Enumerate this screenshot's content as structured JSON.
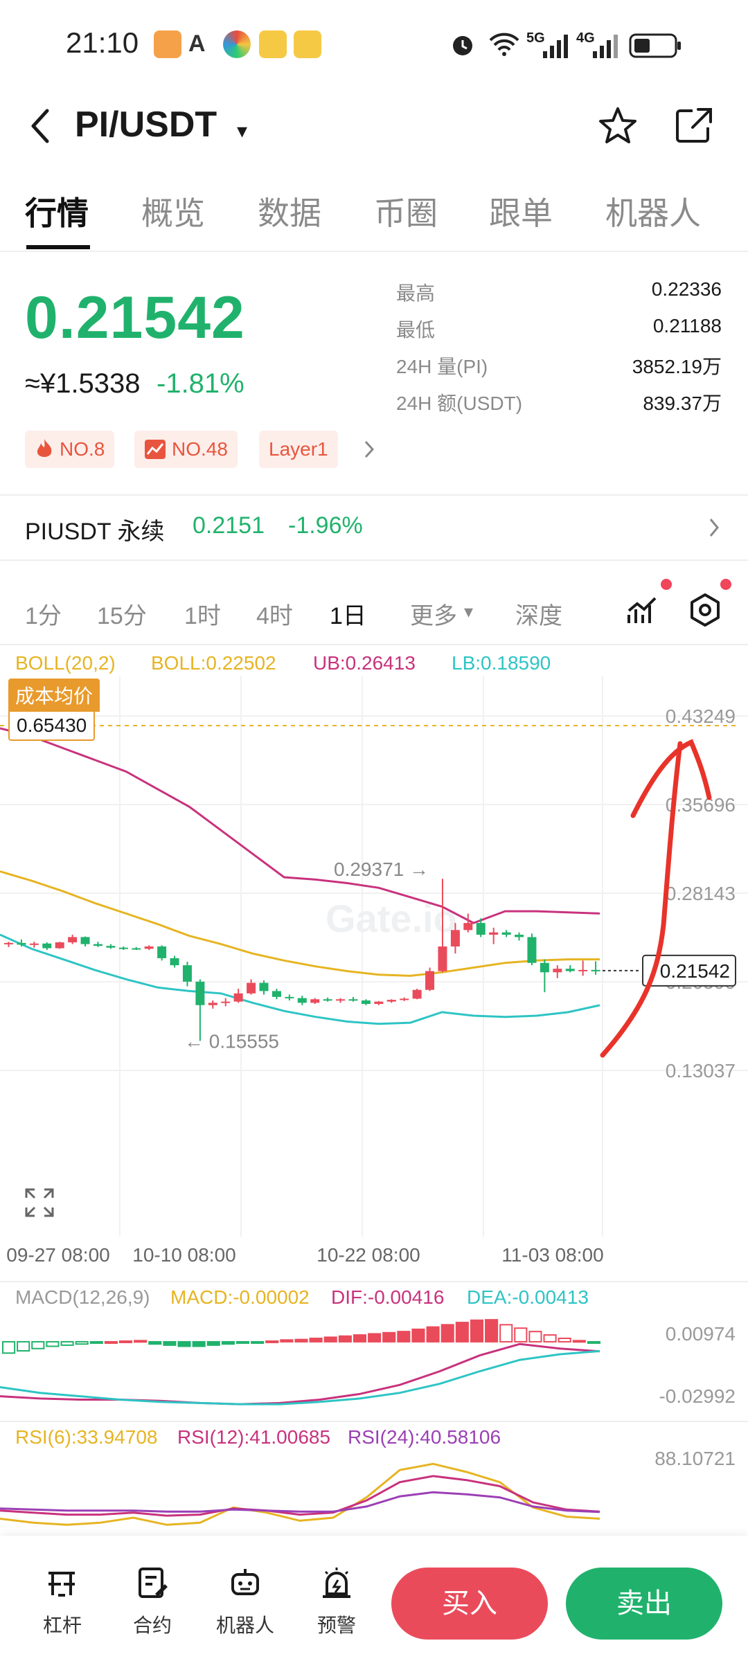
{
  "status_bar": {
    "time": "21:10",
    "network_5g": "5G",
    "network_4g": "4G"
  },
  "header": {
    "pair": "PI/USDT",
    "caret": "▾"
  },
  "tabs": [
    {
      "label": "行情"
    },
    {
      "label": "概览"
    },
    {
      "label": "数据"
    },
    {
      "label": "币圈"
    },
    {
      "label": "跟单"
    },
    {
      "label": "机器人"
    }
  ],
  "price": {
    "last": "0.21542",
    "cny": "≈¥1.5338",
    "change": "-1.81%"
  },
  "stats": [
    {
      "label": "最高",
      "value": "0.22336"
    },
    {
      "label": "最低",
      "value": "0.21188"
    },
    {
      "label": "24H 量(PI)",
      "value": "3852.19万"
    },
    {
      "label": "24H 额(USDT)",
      "value": "839.37万"
    }
  ],
  "tags": [
    "NO.8",
    "NO.48",
    "Layer1"
  ],
  "perpetual": {
    "name": "PIUSDT 永续",
    "price": "0.2151",
    "change": "-1.96%"
  },
  "intervals": [
    {
      "label": "1分"
    },
    {
      "label": "15分"
    },
    {
      "label": "1时"
    },
    {
      "label": "4时"
    },
    {
      "label": "1日"
    },
    {
      "label": "更多"
    },
    {
      "label": "深度"
    }
  ],
  "more_caret": "▾",
  "boll": {
    "name": "BOLL(20,2)",
    "boll": "BOLL:0.22502",
    "ub": "UB:0.26413",
    "lb": "LB:0.18590"
  },
  "cost_avg": {
    "label": "成本均价",
    "value": "0.65430"
  },
  "watermark": "Gate.io",
  "chart_data": [
    {
      "type": "candlestick",
      "title": "",
      "y_ticks": [
        "0.43249",
        "0.35696",
        "0.28143",
        "0.20590",
        "0.13037"
      ],
      "x_ticks": [
        "09-27 08:00",
        "10-10 08:00",
        "10-22 08:00",
        "11-03 08:00"
      ],
      "current_price_label": "0.21542",
      "high_annotation": "0.29371 →",
      "low_annotation": "← 0.15555",
      "ylim": [
        0.13037,
        0.43249
      ],
      "candles": [
        [
          0.238,
          0.24,
          0.2355,
          0.239
        ],
        [
          0.239,
          0.242,
          0.236,
          0.2375
        ],
        [
          0.2375,
          0.24,
          0.235,
          0.2385
        ],
        [
          0.2385,
          0.2395,
          0.233,
          0.2345
        ],
        [
          0.2345,
          0.24,
          0.234,
          0.2395
        ],
        [
          0.2395,
          0.246,
          0.238,
          0.244
        ],
        [
          0.244,
          0.2445,
          0.236,
          0.238
        ],
        [
          0.238,
          0.24,
          0.2355,
          0.2365
        ],
        [
          0.2365,
          0.238,
          0.234,
          0.235
        ],
        [
          0.235,
          0.236,
          0.233,
          0.2345
        ],
        [
          0.2345,
          0.2355,
          0.233,
          0.234
        ],
        [
          0.234,
          0.237,
          0.233,
          0.236
        ],
        [
          0.236,
          0.237,
          0.224,
          0.226
        ],
        [
          0.226,
          0.228,
          0.218,
          0.22
        ],
        [
          0.22,
          0.223,
          0.202,
          0.206
        ],
        [
          0.206,
          0.208,
          0.1555,
          0.186
        ],
        [
          0.186,
          0.19,
          0.183,
          0.188
        ],
        [
          0.188,
          0.192,
          0.185,
          0.189
        ],
        [
          0.189,
          0.2,
          0.188,
          0.196
        ],
        [
          0.196,
          0.208,
          0.195,
          0.205
        ],
        [
          0.205,
          0.207,
          0.195,
          0.198
        ],
        [
          0.198,
          0.2,
          0.191,
          0.193
        ],
        [
          0.193,
          0.195,
          0.19,
          0.192
        ],
        [
          0.192,
          0.194,
          0.186,
          0.188
        ],
        [
          0.188,
          0.192,
          0.187,
          0.191
        ],
        [
          0.191,
          0.1925,
          0.189,
          0.19
        ],
        [
          0.19,
          0.192,
          0.188,
          0.191
        ],
        [
          0.191,
          0.193,
          0.189,
          0.19
        ],
        [
          0.19,
          0.191,
          0.186,
          0.187
        ],
        [
          0.187,
          0.1895,
          0.186,
          0.189
        ],
        [
          0.189,
          0.191,
          0.188,
          0.1905
        ],
        [
          0.1905,
          0.1925,
          0.1895,
          0.1915
        ],
        [
          0.1915,
          0.2,
          0.191,
          0.199
        ],
        [
          0.199,
          0.218,
          0.198,
          0.215
        ],
        [
          0.215,
          0.2937,
          0.214,
          0.236
        ],
        [
          0.236,
          0.256,
          0.23,
          0.25
        ],
        [
          0.25,
          0.264,
          0.248,
          0.256
        ],
        [
          0.256,
          0.26,
          0.244,
          0.246
        ],
        [
          0.246,
          0.252,
          0.238,
          0.248
        ],
        [
          0.248,
          0.25,
          0.244,
          0.246
        ],
        [
          0.246,
          0.248,
          0.241,
          0.244
        ],
        [
          0.244,
          0.247,
          0.22,
          0.222
        ],
        [
          0.222,
          0.225,
          0.197,
          0.214
        ],
        [
          0.214,
          0.22,
          0.209,
          0.217
        ],
        [
          0.217,
          0.22,
          0.214,
          0.215
        ],
        [
          0.215,
          0.224,
          0.211,
          0.216
        ],
        [
          0.216,
          0.2234,
          0.2119,
          0.2154
        ]
      ],
      "series": [
        {
          "name": "UB:0.26413",
          "color": "#c8327d",
          "values": [
            0.422,
            0.415,
            0.405,
            0.395,
            0.385,
            0.37,
            0.355,
            0.335,
            0.315,
            0.295,
            0.293,
            0.29,
            0.286,
            0.278,
            0.27,
            0.256,
            0.266,
            0.266,
            0.265,
            0.2641
          ]
        },
        {
          "name": "BOLL:0.22502",
          "color": "#e6b422",
          "values": [
            0.3,
            0.292,
            0.283,
            0.273,
            0.264,
            0.255,
            0.245,
            0.238,
            0.23,
            0.224,
            0.219,
            0.215,
            0.212,
            0.211,
            0.214,
            0.218,
            0.222,
            0.224,
            0.225,
            0.225
          ]
        },
        {
          "name": "LB:0.18590",
          "color": "#2ec4c4",
          "values": [
            0.246,
            0.234,
            0.225,
            0.216,
            0.208,
            0.201,
            0.198,
            0.196,
            0.188,
            0.181,
            0.176,
            0.172,
            0.17,
            0.171,
            0.18,
            0.177,
            0.176,
            0.177,
            0.18,
            0.1859
          ]
        }
      ]
    },
    {
      "type": "bar",
      "title": "",
      "legend": [
        "MACD(12,26,9)",
        "MACD:-0.00002",
        "DIF:-0.00416",
        "DEA:-0.00413"
      ],
      "y_ticks": [
        "0.00974",
        "-0.02992"
      ],
      "ylim": [
        -0.02992,
        0.00974
      ],
      "histogram": [
        -0.005,
        -0.004,
        -0.003,
        -0.002,
        -0.0015,
        -0.001,
        -0.0005,
        0,
        0.0003,
        0.0005,
        -0.001,
        -0.0015,
        -0.002,
        -0.002,
        -0.0015,
        -0.001,
        -0.0005,
        -0.0002,
        0.0003,
        0.0008,
        0.001,
        0.0015,
        0.002,
        0.0025,
        0.003,
        0.0035,
        0.004,
        0.0045,
        0.0055,
        0.0065,
        0.0075,
        0.0085,
        0.0095,
        0.0097,
        0.0075,
        0.006,
        0.0045,
        0.003,
        0.0015,
        0.0005,
        -2e-05
      ],
      "series": [
        {
          "name": "DIF:-0.00416",
          "color": "#c8327d",
          "values": [
            -0.024,
            -0.025,
            -0.0255,
            -0.0255,
            -0.026,
            -0.027,
            -0.0275,
            -0.027,
            -0.0255,
            -0.023,
            -0.019,
            -0.013,
            -0.006,
            -0.001,
            -0.003,
            -0.0042
          ]
        },
        {
          "name": "DEA:-0.00413",
          "color": "#2ec4c4",
          "values": [
            -0.02,
            -0.0225,
            -0.024,
            -0.0255,
            -0.0265,
            -0.027,
            -0.0275,
            -0.0275,
            -0.0265,
            -0.025,
            -0.0225,
            -0.0185,
            -0.013,
            -0.008,
            -0.0055,
            -0.0041
          ]
        }
      ]
    },
    {
      "type": "line",
      "title": "",
      "legend": [
        "RSI(6):33.94708",
        "RSI(12):41.00685",
        "RSI(24):40.58106"
      ],
      "y_ticks": [
        "88.10721"
      ],
      "ylim": [
        20,
        95
      ],
      "series": [
        {
          "name": "RSI(6):33.94708",
          "color": "#e6b422",
          "values": [
            34,
            30,
            28,
            30,
            35,
            28,
            30,
            45,
            40,
            32,
            35,
            55,
            82,
            88,
            80,
            70,
            45,
            36,
            34
          ]
        },
        {
          "name": "RSI(12):41.00685",
          "color": "#c8327d",
          "values": [
            42,
            40,
            38,
            38,
            40,
            37,
            38,
            44,
            42,
            38,
            40,
            52,
            70,
            76,
            72,
            66,
            50,
            43,
            41
          ]
        },
        {
          "name": "RSI(24):40.58106",
          "color": "#9b3fb5",
          "values": [
            44,
            43,
            42,
            42,
            42,
            41,
            41,
            43,
            42,
            41,
            41,
            46,
            56,
            60,
            58,
            55,
            46,
            42,
            40.6
          ]
        }
      ]
    }
  ],
  "bottom_nav": [
    {
      "label": "杠杆"
    },
    {
      "label": "合约"
    },
    {
      "label": "机器人"
    },
    {
      "label": "预警"
    }
  ],
  "buy_label": "买入",
  "sell_label": "卖出",
  "colors": {
    "up": "#20b26c",
    "down": "#ea4b5b",
    "annotation": "#e8332a"
  }
}
